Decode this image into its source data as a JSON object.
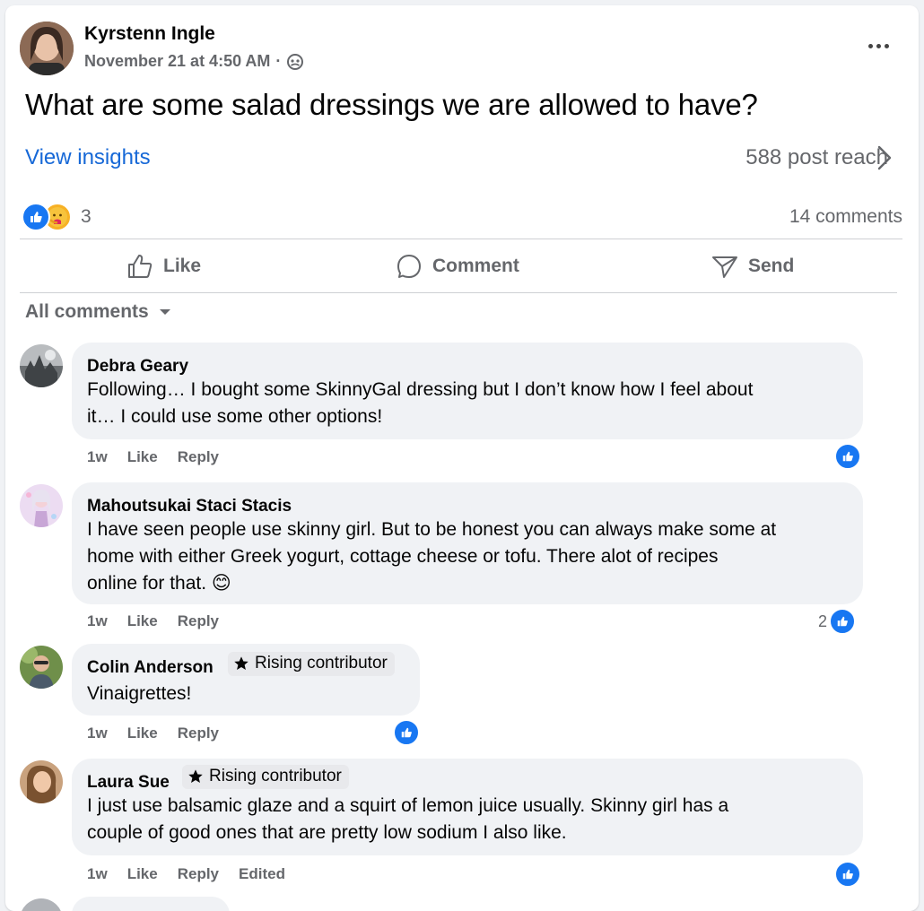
{
  "post": {
    "author": "Kyrstenn Ingle",
    "timestamp": "November 21 at 4:50 AM",
    "separator": "·",
    "text": "What are some salad dressings we are allowed to have?",
    "insights_label": "View insights",
    "reach_label": "588 post reach",
    "reaction_count": "3",
    "comments_count": "14 comments"
  },
  "actions": {
    "like": "Like",
    "comment": "Comment",
    "send": "Send"
  },
  "filter": {
    "label": "All comments"
  },
  "comments": [
    {
      "name": "Debra Geary",
      "badge": "",
      "lines": [
        "Following… I bought some SkinnyGal dressing but I don’t know how I feel about",
        "it… I could use some other options!"
      ],
      "age": "1w",
      "like": "Like",
      "reply": "Reply",
      "edited": "",
      "likes": ""
    },
    {
      "name": "Mahoutsukai Staci Stacis",
      "badge": "",
      "lines": [
        "I have seen people use skinny girl. But to be honest you can always make some at",
        "home with either Greek yogurt, cottage cheese or tofu. There alot of recipes",
        "online for that. 😊"
      ],
      "age": "1w",
      "like": "Like",
      "reply": "Reply",
      "edited": "",
      "likes": "2"
    },
    {
      "name": "Colin Anderson",
      "badge": "Rising contributor",
      "lines": [
        "Vinaigrettes!"
      ],
      "age": "1w",
      "like": "Like",
      "reply": "Reply",
      "edited": "",
      "likes": ""
    },
    {
      "name": "Laura Sue",
      "badge": "Rising contributor",
      "lines": [
        "I just use balsamic glaze and a squirt of lemon juice usually. Skinny girl has a",
        "couple of good ones that are pretty low sodium I also like."
      ],
      "age": "1w",
      "like": "Like",
      "reply": "Reply",
      "edited": "Edited",
      "likes": ""
    }
  ],
  "colors": {
    "link": "#1668d7",
    "like_blue": "#1877f2",
    "secondary_text": "#65676b",
    "bubble": "#f0f2f5"
  }
}
